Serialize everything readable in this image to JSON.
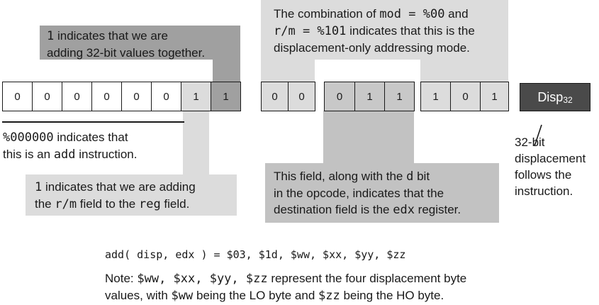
{
  "callouts": {
    "top_left": {
      "pre_code": "1",
      "line1_rest": " indicates that we are",
      "line2": "adding 32-bit values together."
    },
    "top_right": {
      "line1_a": "The combination of ",
      "line1_code": "mod = %00",
      "line1_b": " and",
      "line2_code": "r/m = %101",
      "line2_b": " indicates that this is the",
      "line3": "displacement-only addressing mode."
    },
    "bottom_left": {
      "line1_code": "1",
      "line1_rest": " indicates that we are adding",
      "line2_a": "the ",
      "line2_code1": "r/m",
      "line2_b": " field to the ",
      "line2_code2": "reg",
      "line2_c": " field."
    },
    "bottom_mid": {
      "line1_a": "This field, along with the ",
      "line1_code": "d",
      "line1_b": " bit",
      "line2": "in the opcode, indicates that the",
      "line3_a": "destination field is the ",
      "line3_code": "edx",
      "line3_b": " register."
    }
  },
  "opcode_note": {
    "line1_code": "%000000",
    "line1_rest": " indicates that",
    "line2_a": "this is an ",
    "line2_code": "add",
    "line2_b": " instruction."
  },
  "opcode_bits": [
    "0",
    "0",
    "0",
    "0",
    "0",
    "0",
    "1",
    "1"
  ],
  "mod_bits": [
    "0",
    "0"
  ],
  "reg_bits": [
    "0",
    "1",
    "1"
  ],
  "rm_bits": [
    "1",
    "0",
    "1"
  ],
  "disp_box": {
    "label": "Disp",
    "subscript": "32"
  },
  "disp_note": {
    "line1": "32-bit",
    "line2": "displacement",
    "line3": "follows the",
    "line4": "instruction."
  },
  "encoding_line": "add( disp, edx ) = $03, $1d, $ww, $xx, $yy, $zz",
  "note": {
    "line1_a": "Note: ",
    "line1_codes": "$ww, $xx, $yy, $zz",
    "line1_b": " represent the four displacement byte",
    "line2_a": "values, with ",
    "line2_code1": "$ww",
    "line2_b": " being the LO byte and ",
    "line2_code2": "$zz",
    "line2_c": " being the HO byte."
  },
  "colors": {
    "dark_gray": "#a0a0a0",
    "light_gray": "#dcdcdc",
    "mid_gray": "#c2c2c2",
    "disp_fill": "#4a4a4a"
  }
}
